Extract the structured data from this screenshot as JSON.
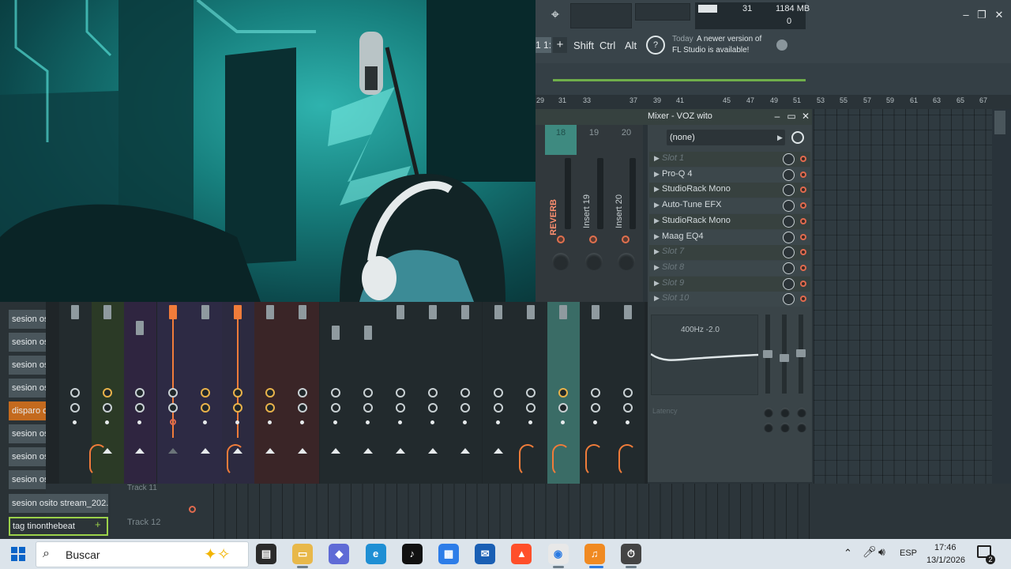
{
  "fl_toolbar": {
    "cpu_value": "31",
    "ram_value": "1184 MB",
    "poly_value": "0",
    "pattern_number": "1 1:",
    "add_label": "+",
    "modifier_keys": [
      "Shift",
      "Ctrl",
      "Alt"
    ],
    "news_day": "Today",
    "news_line1": "A newer version of",
    "news_line2": "FL Studio is available!",
    "window_controls": [
      "–",
      "❐",
      "✕"
    ]
  },
  "playlist": {
    "ruler_ticks": [
      "29",
      "31",
      "33",
      "37",
      "39",
      "41",
      "45",
      "47",
      "49",
      "51",
      "53",
      "55",
      "57",
      "59",
      "61",
      "63",
      "65",
      "67"
    ],
    "track_label_top": "Track 11",
    "track_label": "Track 12"
  },
  "mixer": {
    "title": "Mixer - VOZ wito",
    "header_controls": [
      "–",
      "▭",
      "✕"
    ],
    "strip_numbers": [
      "18",
      "19",
      "20"
    ],
    "strip_names": [
      "REVERB",
      "Insert 19",
      "Insert 20"
    ],
    "route_value": "(none)",
    "slots": [
      {
        "name": "Slot 1",
        "empty": true
      },
      {
        "name": "Pro-Q 4",
        "empty": false
      },
      {
        "name": "StudioRack Mono",
        "empty": false
      },
      {
        "name": "Auto-Tune EFX",
        "empty": false
      },
      {
        "name": "StudioRack Mono",
        "empty": false
      },
      {
        "name": "Maag EQ4",
        "empty": false
      },
      {
        "name": "Slot 7",
        "empty": true
      },
      {
        "name": "Slot 8",
        "empty": true
      },
      {
        "name": "Slot 9",
        "empty": true
      },
      {
        "name": "Slot 10",
        "empty": true
      }
    ],
    "eq_readout": "400Hz -2.0",
    "latency_label": "Latency"
  },
  "browser": {
    "items": [
      "sesion os",
      "sesion os",
      "sesion os",
      "sesion os",
      "disparo c",
      "sesion os",
      "sesion os",
      "sesion os"
    ],
    "wide_item": "sesion osito stream_202...",
    "tag_item": "tag tinonthebeat",
    "tag_icon": "+",
    "colors": {
      "active": "#c46a1e",
      "tag_border": "#9bd14a"
    }
  },
  "taskbar": {
    "search_placeholder": "Buscar",
    "apps": [
      "task-view",
      "file-explorer",
      "copilot",
      "edge",
      "tiktok",
      "store",
      "outlook",
      "brave",
      "chrome",
      "fl-studio",
      "clock-app"
    ],
    "tray_lang": "ESP",
    "time": "17:46",
    "date": "13/1/2026",
    "notification_count": "2"
  }
}
